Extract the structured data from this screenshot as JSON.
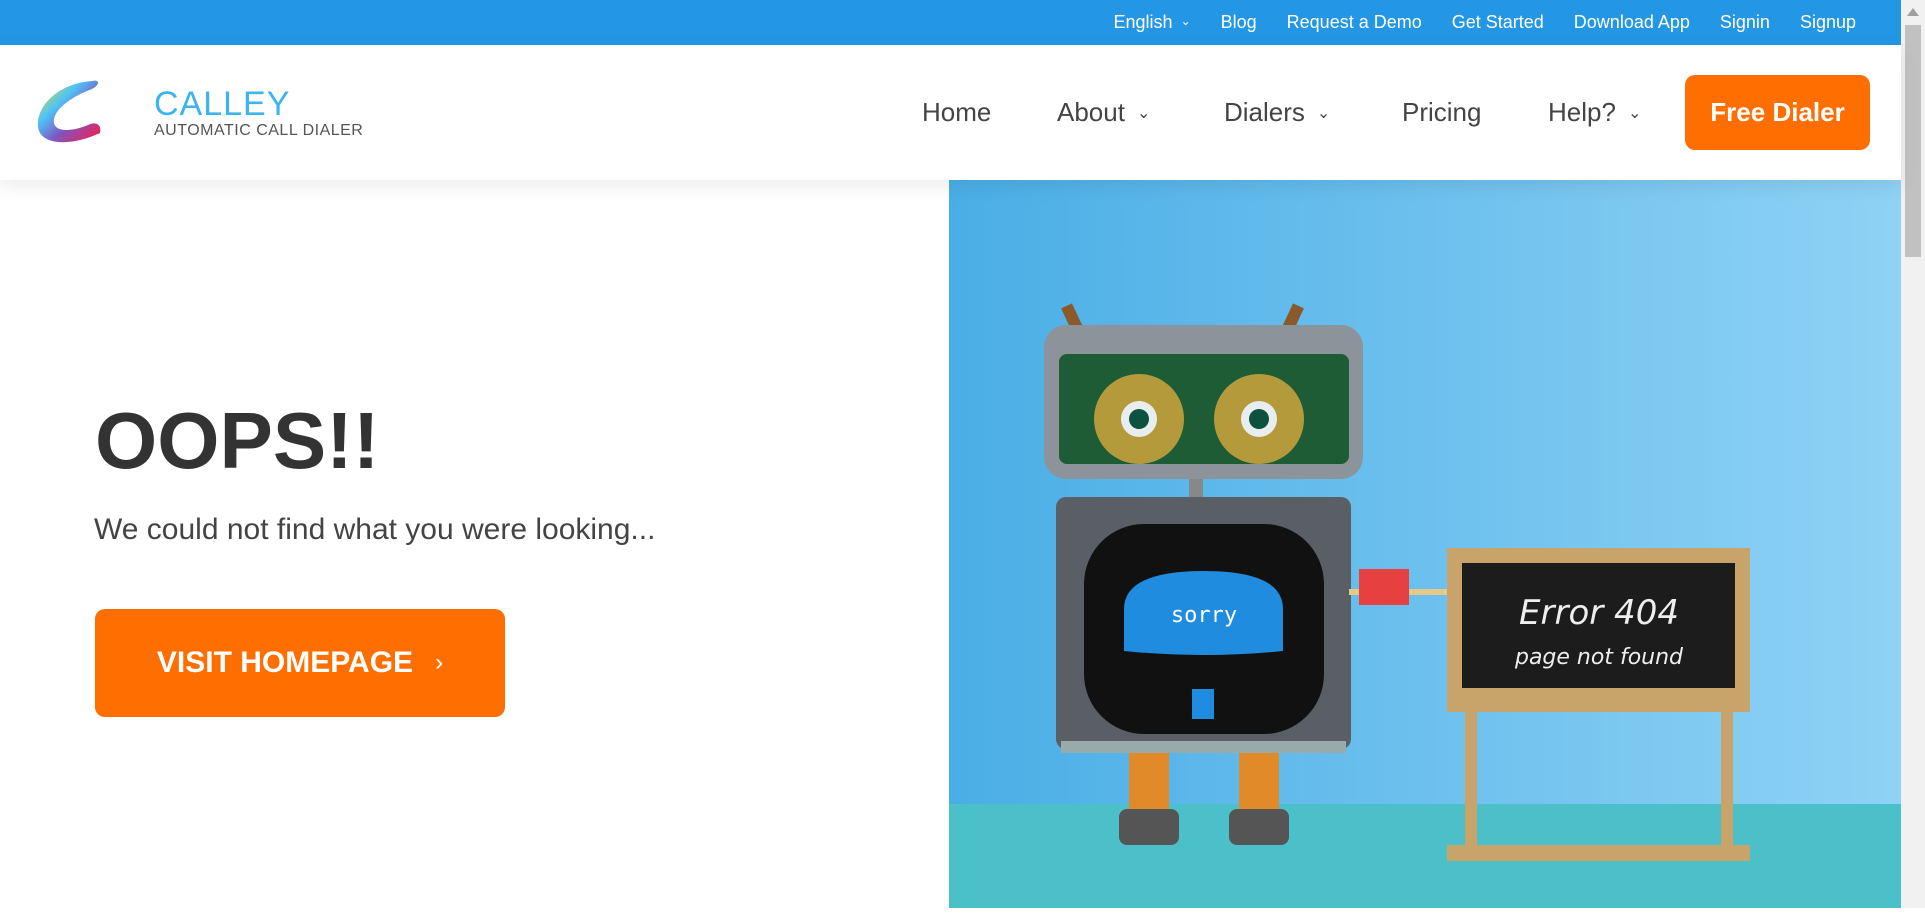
{
  "topbar": {
    "links": [
      "English",
      "Blog",
      "Request a Demo",
      "Get Started",
      "Download App",
      "Signin",
      "Signup"
    ]
  },
  "logo": {
    "title": "CALLEY",
    "subtitle": "AUTOMATIC CALL DIALER"
  },
  "nav": {
    "home": "Home",
    "about": "About",
    "dialers": "Dialers",
    "pricing": "Pricing",
    "help": "Help?",
    "cta": "Free Dialer"
  },
  "main": {
    "title": "OOPS!!",
    "subtitle": "We could not find what you were looking...",
    "button": "VISIT HOMEPAGE"
  },
  "hero": {
    "screen_text": "sorry",
    "board_line1": "Error 404",
    "board_line2": "page not found"
  },
  "colors": {
    "topbar": "#2396e6",
    "accent": "#ff6e00",
    "logo": "#3cb4f0"
  }
}
